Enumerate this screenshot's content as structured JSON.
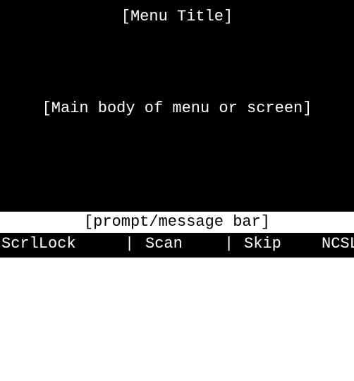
{
  "screen": {
    "menu_title": "[Menu Title]",
    "main_body": "[Main body of menu or screen]"
  },
  "prompt_bar": {
    "text": "[prompt/message bar]"
  },
  "key_bar": {
    "scrllock": "ScrlLock",
    "separator1": "|",
    "scan": "Scan",
    "separator2": "|",
    "skip": "Skip",
    "ncsl": "NCSL"
  },
  "colors": {
    "screen_background": "#000000",
    "screen_text": "#ffffff",
    "prompt_background": "#ffffff",
    "prompt_text": "#000000"
  }
}
